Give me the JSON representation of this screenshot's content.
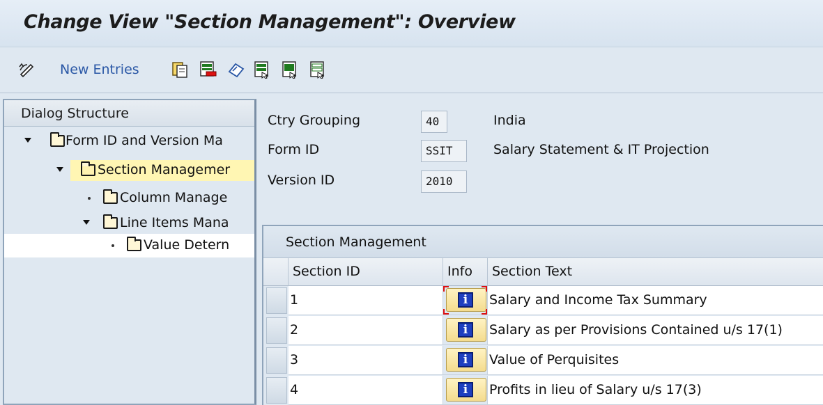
{
  "window": {
    "title": "Change View \"Section Management\": Overview"
  },
  "toolbar": {
    "new_entries_label": "New Entries",
    "icons": [
      "display-change-icon",
      "copy-as-icon",
      "delete-icon",
      "undo-change-icon",
      "select-all-icon",
      "select-block-icon",
      "deselect-all-icon"
    ]
  },
  "dialog_structure": {
    "header": "Dialog Structure",
    "items": [
      {
        "label": "Form ID and Version Ma",
        "level": 1,
        "expanded": true,
        "selected": false
      },
      {
        "label": "Section Managemer",
        "level": 2,
        "expanded": true,
        "selected": true
      },
      {
        "label": "Column Manage",
        "level": 3,
        "expanded": false,
        "selected": false
      },
      {
        "label": "Line Items Mana",
        "level": 3,
        "expanded": true,
        "selected": false
      },
      {
        "label": "Value Detern",
        "level": 4,
        "expanded": false,
        "selected": false
      }
    ]
  },
  "header_fields": [
    {
      "label": "Ctry Grouping",
      "value": "40",
      "description": "India"
    },
    {
      "label": "Form ID",
      "value": "SSIT",
      "description": "Salary Statement & IT Projection"
    },
    {
      "label": "Version ID",
      "value": "2010",
      "description": ""
    }
  ],
  "table": {
    "title": "Section Management",
    "columns": [
      "Section ID",
      "Info",
      "Section Text"
    ],
    "rows": [
      {
        "section_id": "1",
        "section_text": "Salary and Income Tax Summary"
      },
      {
        "section_id": "2",
        "section_text": "Salary as per Provisions Contained u/s 17(1)"
      },
      {
        "section_id": "3",
        "section_text": "Value of Perquisites"
      },
      {
        "section_id": "4",
        "section_text": "Profits in lieu of Salary u/s 17(3)"
      }
    ],
    "info_icon": "information-icon"
  },
  "colors": {
    "background": "#dfe8f1",
    "link_blue": "#2b58a6",
    "selected_node": "#fff6b3",
    "info_button": "#f4dc8e"
  }
}
